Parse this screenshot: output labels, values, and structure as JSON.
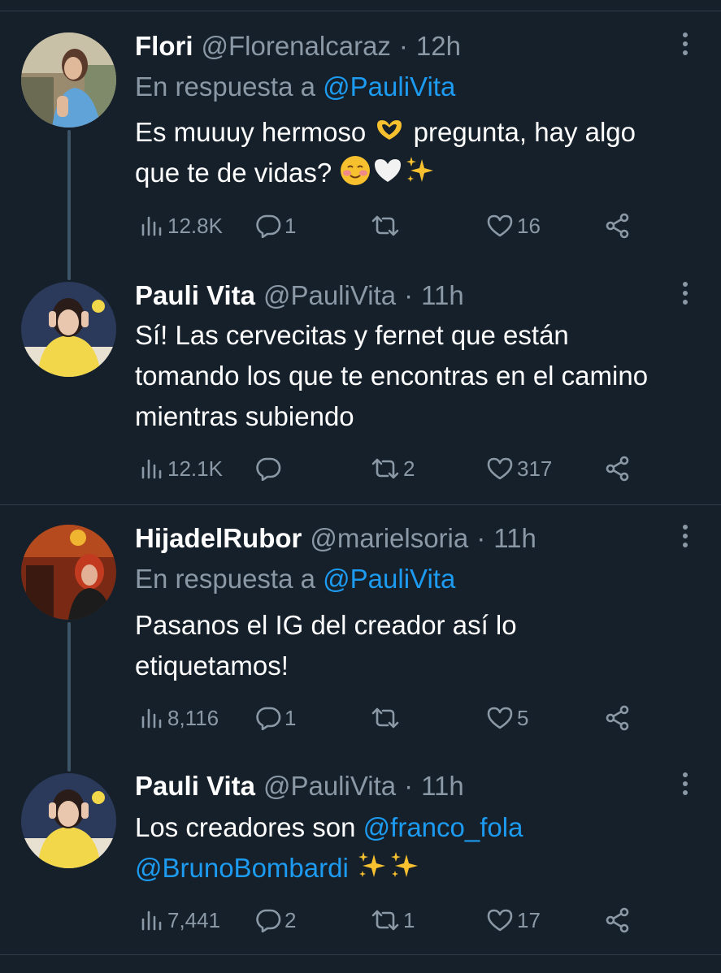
{
  "tweets": [
    {
      "name": "Flori",
      "handle": "@Florenalcaraz",
      "dot": "·",
      "time": "12h",
      "reply_prefix": "En respuesta a ",
      "reply_handle": "@PauliVita",
      "text_1": "Es muuuy hermoso ",
      "text_2": " pregunta, hay algo que te de vidas? ",
      "views": "12.8K",
      "replies": "1",
      "retweets": "",
      "likes": "16"
    },
    {
      "name": "Pauli Vita",
      "handle": "@PauliVita",
      "dot": "·",
      "time": "11h",
      "text": "Sí! Las cervecitas y fernet que están tomando los que te encontras en el camino mientras subiendo",
      "views": "12.1K",
      "replies": "",
      "retweets": "2",
      "likes": "317"
    },
    {
      "name": "HijadelRubor",
      "handle": "@marielsoria",
      "dot": "·",
      "time": "11h",
      "reply_prefix": "En respuesta a ",
      "reply_handle": "@PauliVita",
      "text": "Pasanos el IG del creador así lo etiquetamos!",
      "views": "8,116",
      "replies": "1",
      "retweets": "",
      "likes": "5"
    },
    {
      "name": "Pauli Vita",
      "handle": "@PauliVita",
      "dot": "·",
      "time": "11h",
      "text_1": "Los creadores son ",
      "mention_1": "@franco_fola",
      "mention_2": "@BrunoBombardi",
      "views": "7,441",
      "replies": "2",
      "retweets": "1",
      "likes": "17"
    }
  ],
  "icons": {
    "views": "bar-chart-icon",
    "reply": "speech-bubble-icon",
    "retweet": "retweet-arrows-icon",
    "like": "heart-icon",
    "share": "share-nodes-icon",
    "more": "vertical-dots-icon"
  },
  "colors": {
    "background": "#15202b",
    "muted": "#8b98a5",
    "link": "#1d9bf0",
    "thread_line": "#3d5466"
  }
}
